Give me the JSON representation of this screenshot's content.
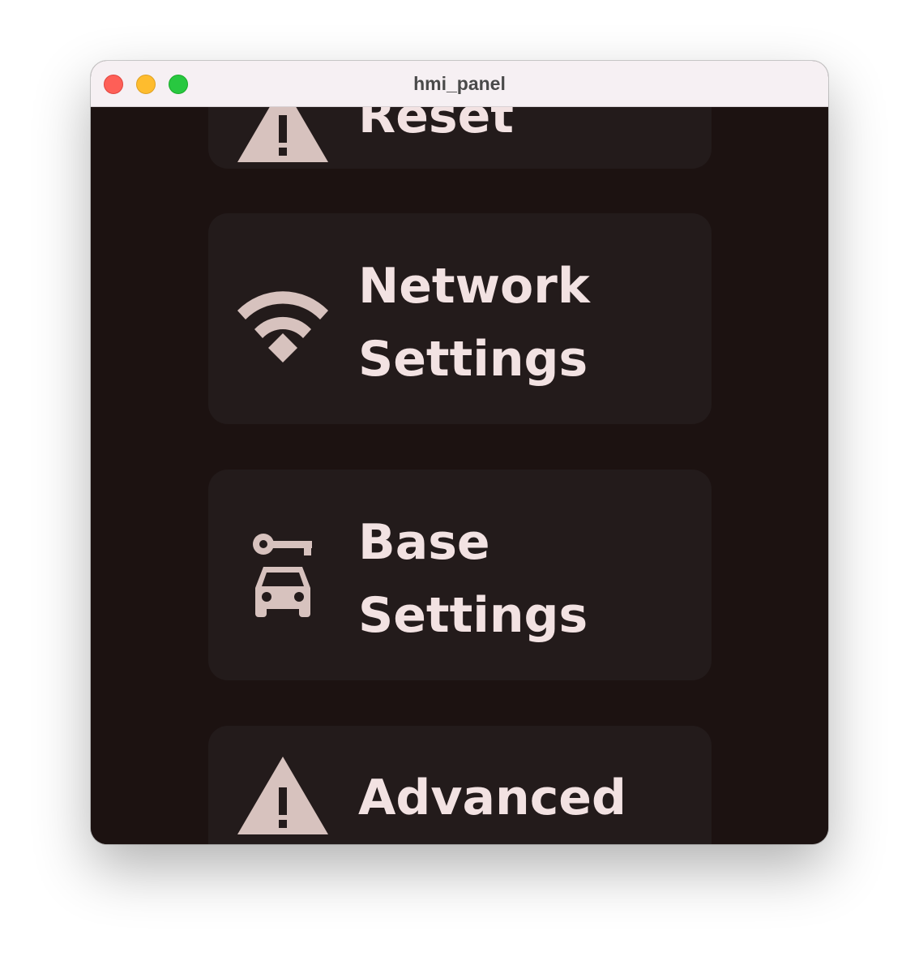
{
  "window": {
    "title": "hmi_panel"
  },
  "menu": {
    "items": [
      {
        "line1": "Reset",
        "line2": "",
        "icon": "warning-icon"
      },
      {
        "line1": "Network",
        "line2": "Settings",
        "icon": "wifi-icon"
      },
      {
        "line1": "Base",
        "line2": "Settings",
        "icon": "car-key-icon"
      },
      {
        "line1": "Advanced",
        "line2": "",
        "icon": "warning-icon"
      }
    ]
  },
  "colors": {
    "background": "#1c1211",
    "card": "#231b1b",
    "text": "#f2e2e2",
    "icon": "#d7c2be",
    "titlebar": "#f6f0f3"
  }
}
